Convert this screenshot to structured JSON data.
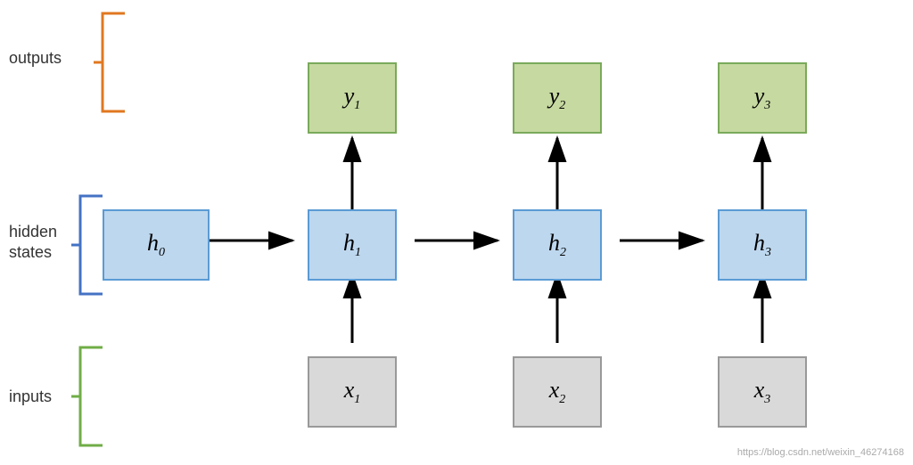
{
  "labels": {
    "outputs": "outputs",
    "hidden_states_1": "hidden",
    "hidden_states_2": "states",
    "inputs": "inputs",
    "watermark": "https://blog.csdn.net/weixin_46274168"
  },
  "colors": {
    "green_border": "#7aaa5a",
    "green_bg": "#c6d9a0",
    "blue_border": "#5b9bd5",
    "blue_bg": "#bdd7ee",
    "gray_border": "#999",
    "gray_bg": "#d9d9d9",
    "orange_bracket": "#e07820",
    "blue_bracket": "#4472c4",
    "green_bracket": "#70ad47"
  },
  "nodes": {
    "y1": {
      "label": "y",
      "sub": "1"
    },
    "y2": {
      "label": "y",
      "sub": "2"
    },
    "y3": {
      "label": "y",
      "sub": "3"
    },
    "h0": {
      "label": "h",
      "sub": "0"
    },
    "h1": {
      "label": "h",
      "sub": "1"
    },
    "h2": {
      "label": "h",
      "sub": "2"
    },
    "h3": {
      "label": "h",
      "sub": "3"
    },
    "x1": {
      "label": "x",
      "sub": "1"
    },
    "x2": {
      "label": "x",
      "sub": "2"
    },
    "x3": {
      "label": "x",
      "sub": "3"
    }
  }
}
